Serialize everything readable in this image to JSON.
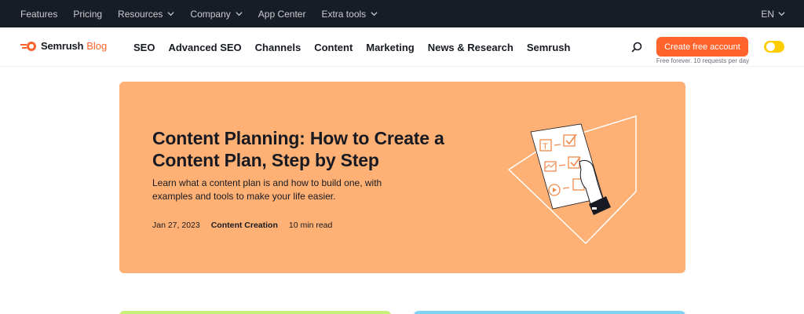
{
  "topbar": {
    "links": [
      "Features",
      "Pricing",
      "Resources",
      "Company",
      "App Center",
      "Extra tools"
    ],
    "language": "EN"
  },
  "nav": {
    "brand": "Semrush",
    "brand_suffix": "Blog",
    "links": [
      "SEO",
      "Advanced SEO",
      "Channels",
      "Content",
      "Marketing",
      "News & Research",
      "Semrush"
    ],
    "cta_label": "Create free account",
    "cta_sub": "Free forever. 10 requests per day"
  },
  "hero": {
    "title": "Content Planning: How to Create a Content Plan, Step by Step",
    "description": "Learn what a content plan is and how to build one, with examples and tools to make your life easier.",
    "date": "Jan 27, 2023",
    "category": "Content Creation",
    "read_time": "10 min read"
  },
  "colors": {
    "topbar_bg": "#181c24",
    "brand_orange": "#ff642d",
    "hero_bg": "#ffb074",
    "toggle": "#ffcc00",
    "card_green": "#c7f27a",
    "card_blue": "#7fd3f2"
  },
  "icons": [
    "chevron-down-icon",
    "semrush-logo-icon",
    "search-icon",
    "theme-toggle-icon"
  ]
}
